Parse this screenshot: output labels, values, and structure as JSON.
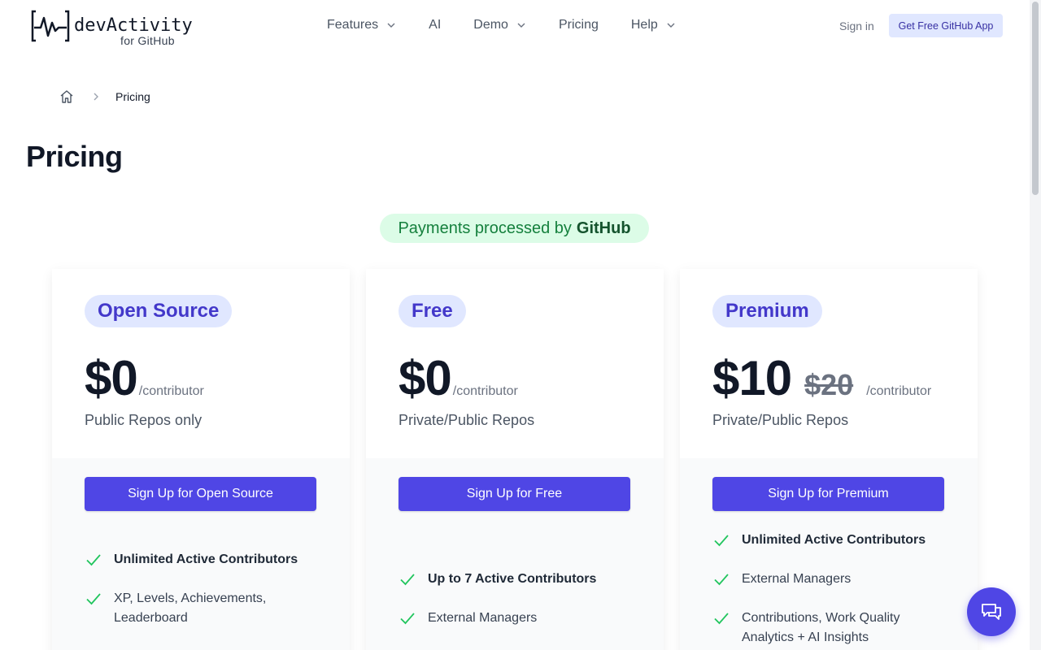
{
  "header": {
    "logo_name": "devActivity",
    "logo_sub": "for GitHub",
    "nav": [
      {
        "label": "Features",
        "has_dropdown": true
      },
      {
        "label": "AI",
        "has_dropdown": false
      },
      {
        "label": "Demo",
        "has_dropdown": true
      },
      {
        "label": "Pricing",
        "has_dropdown": false
      },
      {
        "label": "Help",
        "has_dropdown": true
      }
    ],
    "signin": "Sign in",
    "cta": "Get Free GitHub App"
  },
  "breadcrumb": {
    "home_icon": "home-icon",
    "current": "Pricing"
  },
  "page_title": "Pricing",
  "payments": {
    "prefix": "Payments processed by",
    "provider": "GitHub"
  },
  "plans": [
    {
      "name": "Open Source",
      "price": "$0",
      "old_price": "",
      "per": "/contributor",
      "sub": "Public Repos only",
      "button": "Sign Up for Open Source",
      "features": [
        {
          "text": "Unlimited Active Contributors",
          "bold": true
        },
        {
          "text": "XP, Levels, Achievements, Leaderboard",
          "bold": false
        }
      ]
    },
    {
      "name": "Free",
      "price": "$0",
      "old_price": "",
      "per": "/contributor",
      "sub": "Private/Public Repos",
      "button": "Sign Up for Free",
      "features": [
        {
          "text": "Up to 7 Active Contributors",
          "bold": true
        },
        {
          "text": "External Managers",
          "bold": false
        }
      ]
    },
    {
      "name": "Premium",
      "price": "$10",
      "old_price": "$20",
      "per": "/contributor",
      "sub": "Private/Public Repos",
      "button": "Sign Up for Premium",
      "features": [
        {
          "text": "Unlimited Active Contributors",
          "bold": true
        },
        {
          "text": "External Managers",
          "bold": false
        },
        {
          "text": "Contributions, Work Quality Analytics + AI Insights",
          "bold": false
        }
      ]
    }
  ],
  "colors": {
    "accent": "#4f46e5",
    "badge_bg": "#e0e7ff",
    "check": "#22c55e",
    "payments_bg": "#dcfce7"
  },
  "chat_icon": "chat-icon"
}
